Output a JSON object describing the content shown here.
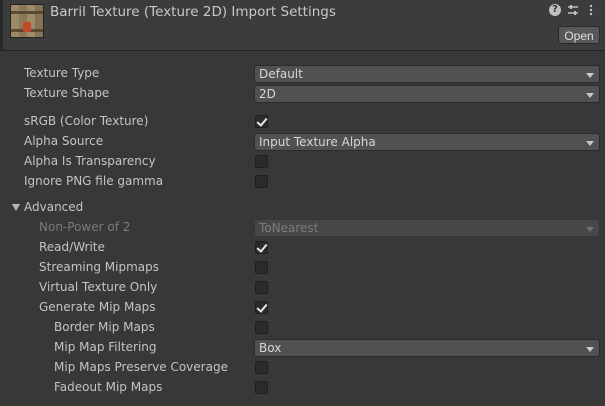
{
  "header": {
    "title": "Barril Texture (Texture 2D) Import Settings",
    "open_label": "Open",
    "icons": [
      "help-icon",
      "presets-icon",
      "more-options-icon"
    ]
  },
  "settings": {
    "texture_type": {
      "label": "Texture Type",
      "value": "Default"
    },
    "texture_shape": {
      "label": "Texture Shape",
      "value": "2D"
    },
    "srgb": {
      "label": "sRGB (Color Texture)",
      "checked": true
    },
    "alpha_source": {
      "label": "Alpha Source",
      "value": "Input Texture Alpha"
    },
    "alpha_is_transparency": {
      "label": "Alpha Is Transparency",
      "checked": false
    },
    "ignore_png_gamma": {
      "label": "Ignore PNG file gamma",
      "checked": false
    }
  },
  "advanced": {
    "label": "Advanced",
    "expanded": true,
    "non_power_of_2": {
      "label": "Non-Power of 2",
      "value": "ToNearest",
      "disabled": true
    },
    "read_write": {
      "label": "Read/Write",
      "checked": true
    },
    "streaming_mipmaps": {
      "label": "Streaming Mipmaps",
      "checked": false
    },
    "virtual_texture_only": {
      "label": "Virtual Texture Only",
      "checked": false
    },
    "generate_mip_maps": {
      "label": "Generate Mip Maps",
      "checked": true
    },
    "border_mip_maps": {
      "label": "Border Mip Maps",
      "checked": false
    },
    "mip_map_filtering": {
      "label": "Mip Map Filtering",
      "value": "Box"
    },
    "mip_maps_preserve_coverage": {
      "label": "Mip Maps Preserve Coverage",
      "checked": false
    },
    "fadeout_mip_maps": {
      "label": "Fadeout Mip Maps",
      "checked": false
    }
  }
}
